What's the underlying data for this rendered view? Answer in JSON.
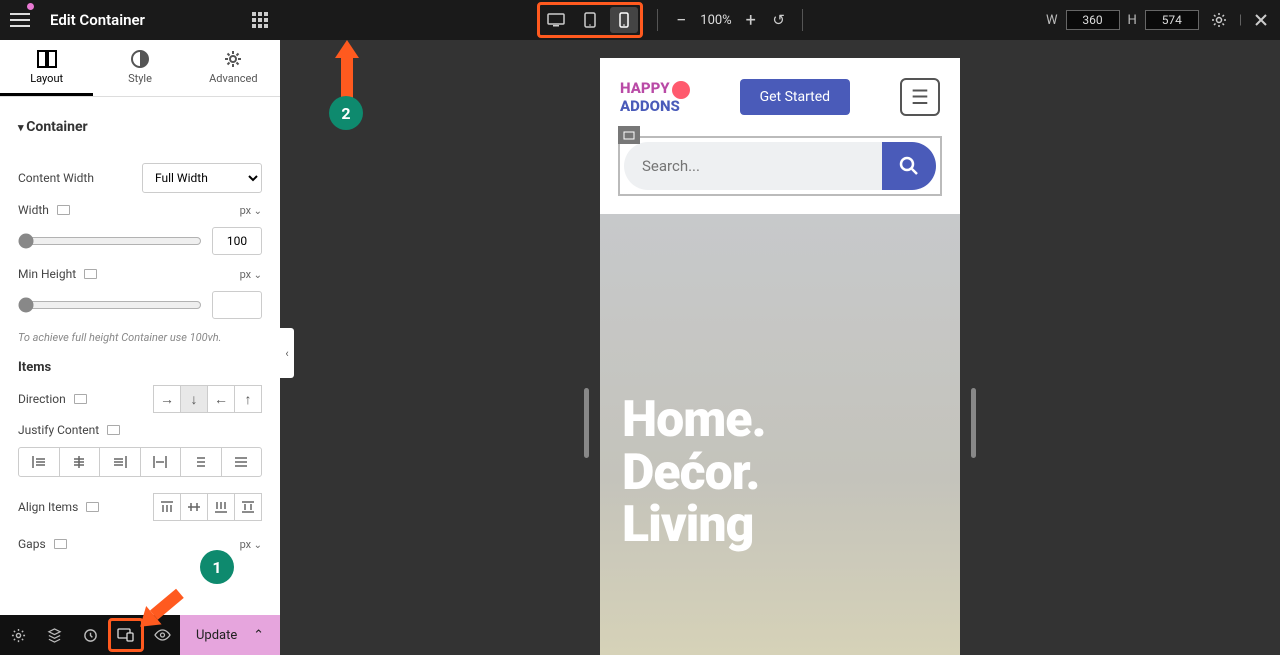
{
  "topbar": {
    "title": "Edit Container",
    "zoom": "100%",
    "width_label": "W",
    "width_value": "360",
    "height_label": "H",
    "height_value": "574"
  },
  "tabs": {
    "layout": "Layout",
    "style": "Style",
    "advanced": "Advanced"
  },
  "panel": {
    "section": "Container",
    "content_width_label": "Content Width",
    "content_width_value": "Full Width",
    "width_label": "Width",
    "width_unit": "px",
    "width_value": "100",
    "min_height_label": "Min Height",
    "min_height_unit": "px",
    "min_height_value": "",
    "hint": "To achieve full height Container use 100vh.",
    "items_head": "Items",
    "direction_label": "Direction",
    "justify_label": "Justify Content",
    "align_label": "Align Items",
    "gaps_label": "Gaps",
    "gaps_unit": "px"
  },
  "footer": {
    "update": "Update"
  },
  "preview": {
    "logo_line1": "HAPPY",
    "logo_line2": "ADDONS",
    "cta": "Get Started",
    "search_placeholder": "Search...",
    "hero_line1": "Home.",
    "hero_line2": "Dećor.",
    "hero_line3": "Living"
  },
  "annotations": {
    "n1": "1",
    "n2": "2"
  }
}
